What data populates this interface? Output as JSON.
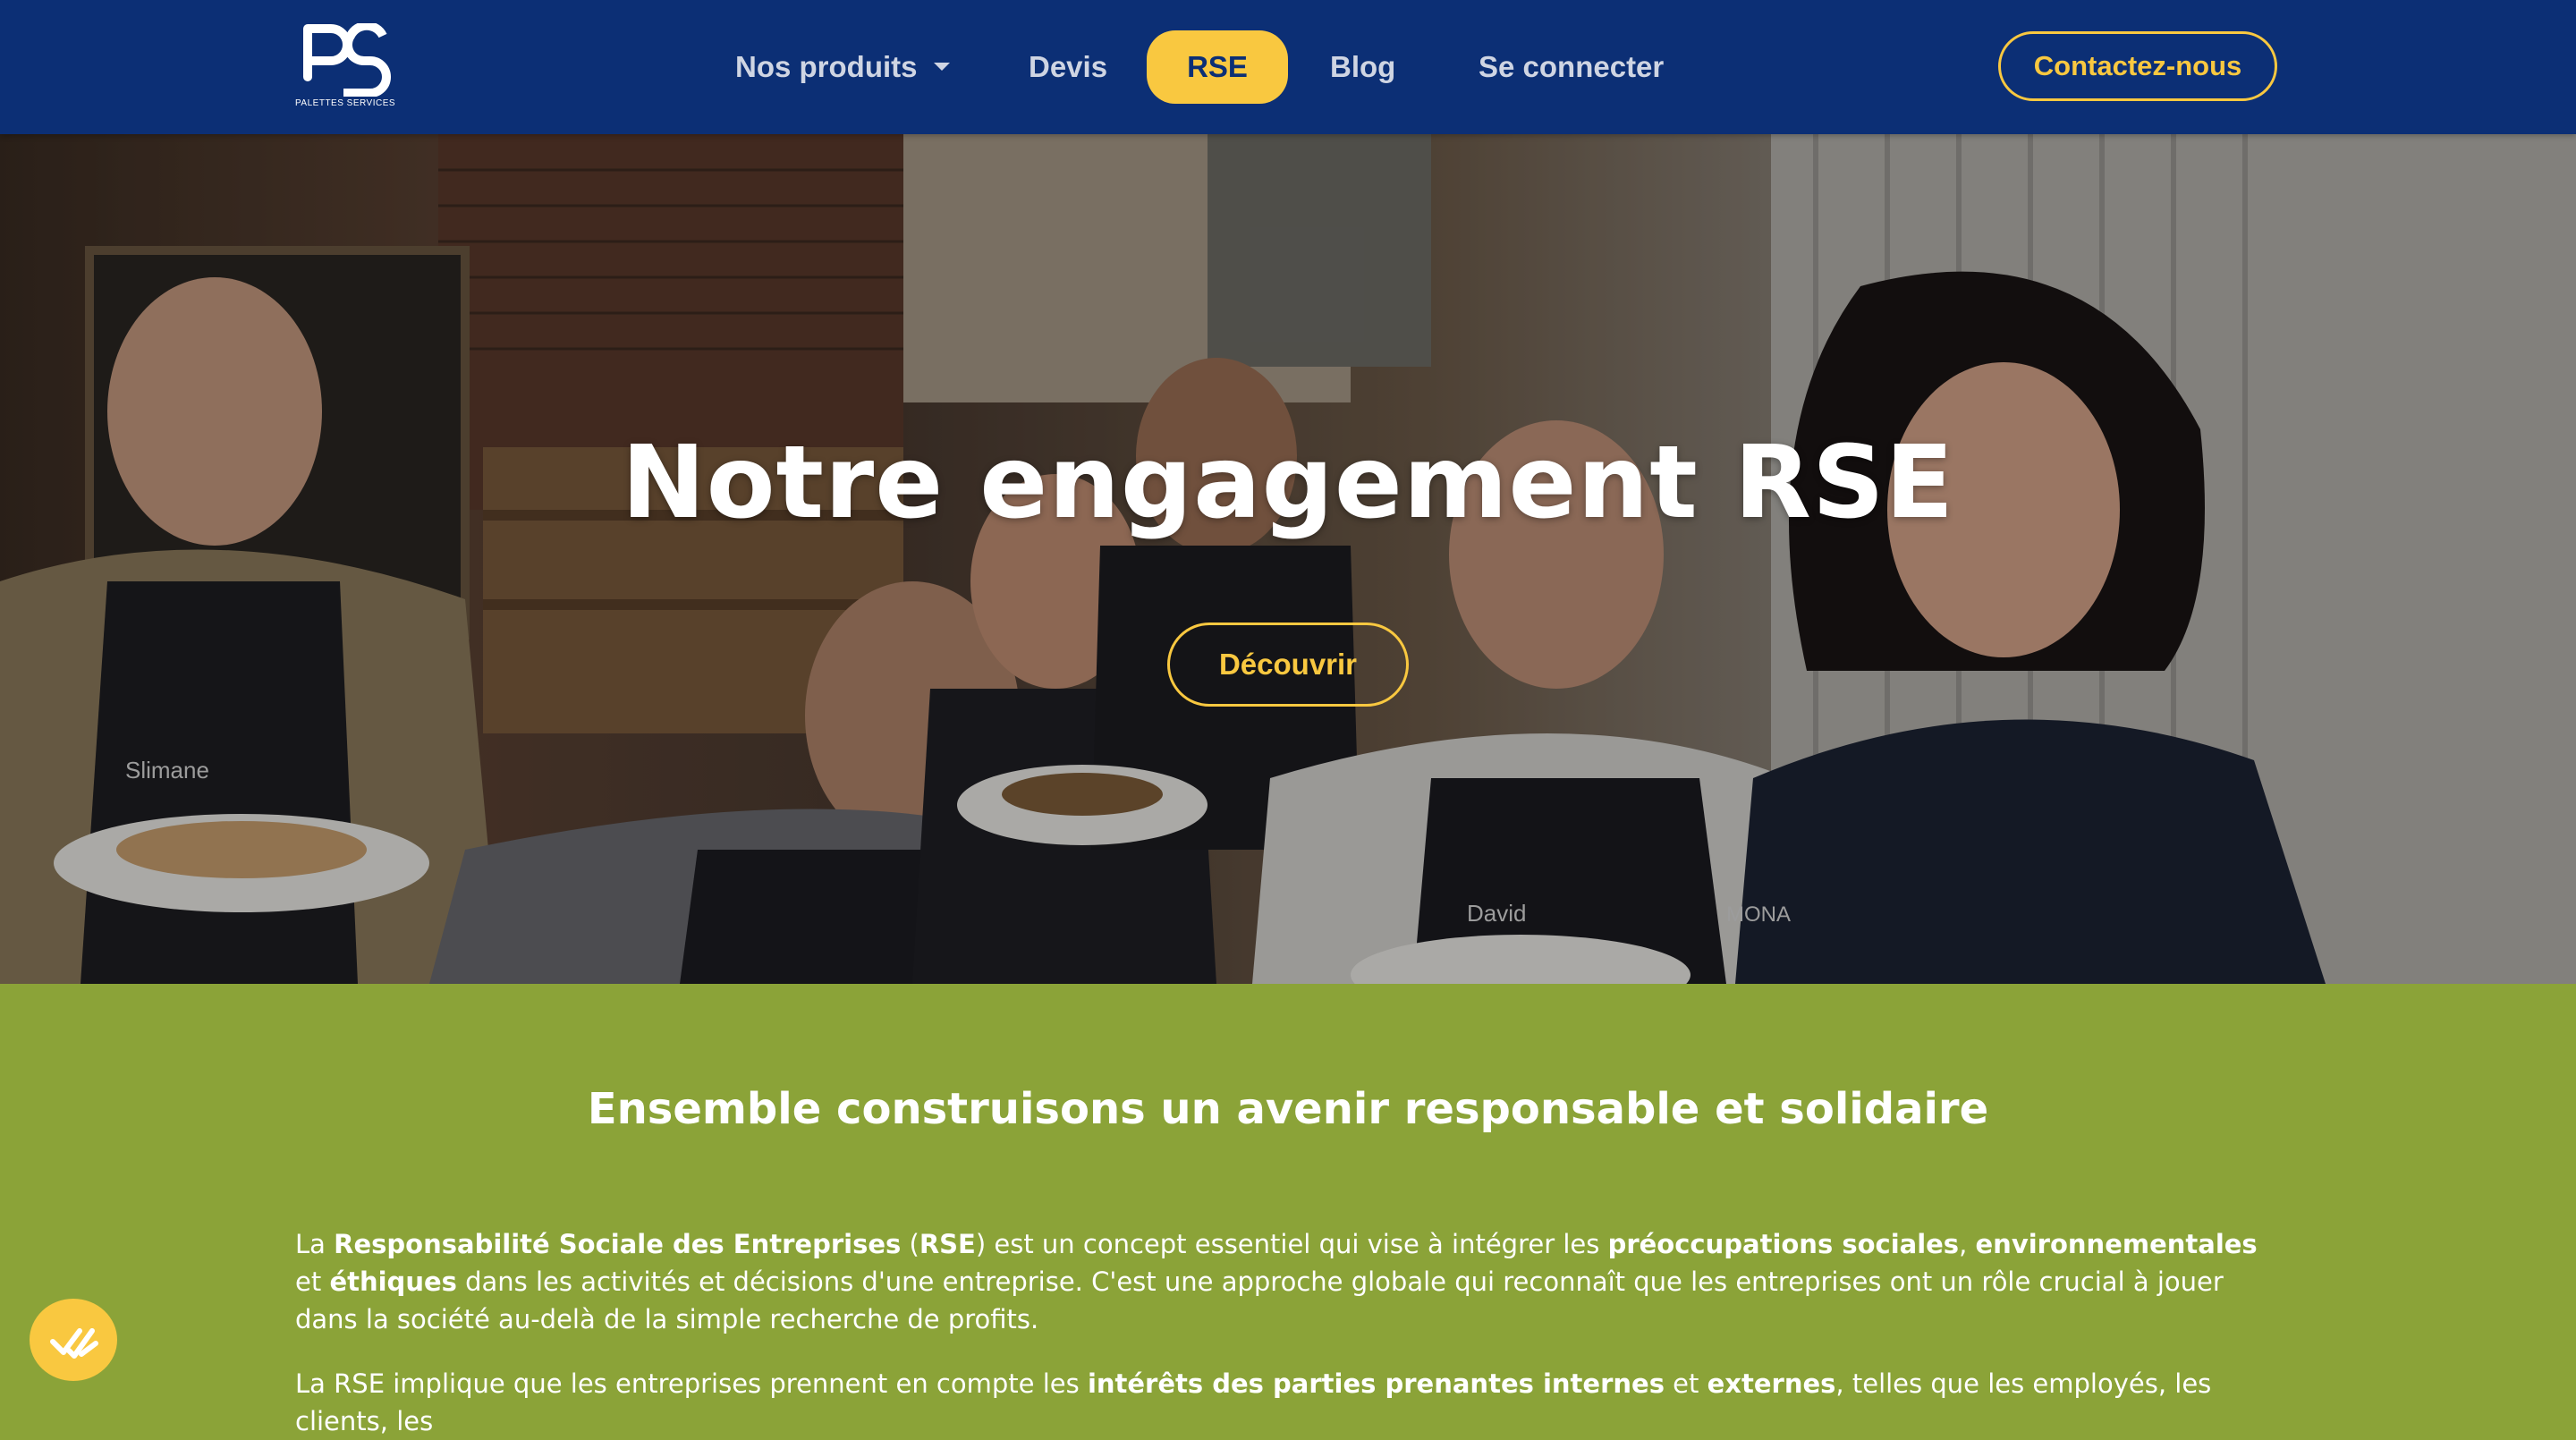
{
  "brand": {
    "logo_letters": "PS",
    "logo_caption": "PALETTES SERVICES"
  },
  "nav": {
    "items": [
      {
        "label": "Nos produits",
        "has_dropdown": true
      },
      {
        "label": "Devis"
      },
      {
        "label": "RSE",
        "active": true
      },
      {
        "label": "Blog"
      },
      {
        "label": "Se connecter"
      }
    ],
    "contact_label": "Contactez-nous"
  },
  "hero": {
    "title": "Notre engagement RSE",
    "cta_label": "Découvrir",
    "apron_names": [
      "Slimane",
      "David",
      "MONA"
    ]
  },
  "content": {
    "subtitle": "Ensemble construisons un avenir responsable et solidaire",
    "para1": {
      "t1": "La ",
      "b1": "Responsabilité Sociale des Entreprises",
      "t2": " (",
      "b2": "RSE",
      "t3": ") est un concept essentiel qui vise à intégrer les ",
      "b3": "préoccupations sociales",
      "t4": ", ",
      "b4": "environnementales",
      "t5": " et ",
      "b5": "éthiques",
      "t6": " dans les activités et décisions d'une entreprise. C'est une approche globale qui reconnaît que les entreprises ont un rôle crucial à jouer dans la société au-delà de la simple recherche de profits."
    },
    "para2": {
      "t1": "La RSE implique que les entreprises prennent en compte les ",
      "b1": "intérêts des parties prenantes internes",
      "t2": " et ",
      "b2": "externes",
      "t3": ", telles que les employés, les clients, les"
    }
  },
  "colors": {
    "navbar": "#0c2f75",
    "accent": "#f9c840",
    "content_bg": "#8ba338",
    "text": "#ffffff"
  },
  "icons": {
    "chat_widget": "chat-check-icon",
    "dropdown": "chevron-down-icon"
  }
}
